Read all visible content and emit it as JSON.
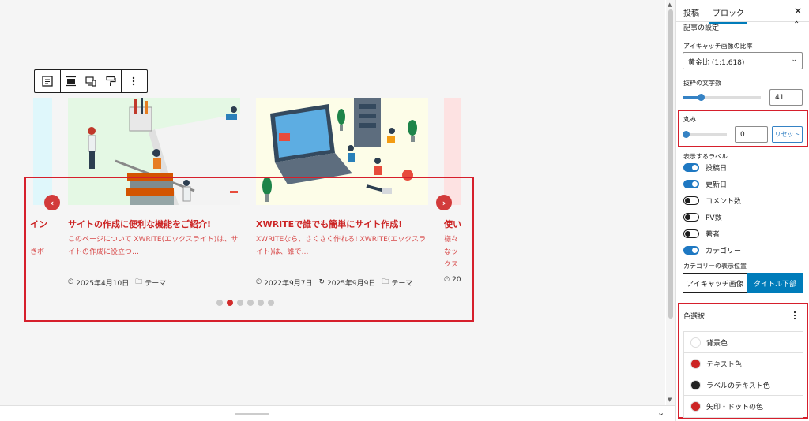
{
  "tabs": {
    "post": "投稿",
    "block": "ブロック"
  },
  "icons": {
    "close": "close-icon",
    "chevron_up": "chevron-up-icon",
    "more": "more-vertical-icon"
  },
  "carousel": {
    "prev_label": "‹",
    "next_label": "›",
    "left_partial": {
      "title": "イン",
      "excerpt": "きボ",
      "meta": "ー"
    },
    "cards": [
      {
        "title": "サイトの作成に便利な機能をご紹介!",
        "excerpt": "このページについて XWRITE(エックスライト)は、サイトの作成に役立つ…",
        "date": "2025年4月10日",
        "category": "テーマ"
      },
      {
        "title": "XWRITEで誰でも簡単にサイト作成!",
        "excerpt": "XWRITEなら、さくさく作れる! XWRITE(エックスライト)は、誰で…",
        "date": "2022年9月7日",
        "updated": "2025年9月9日",
        "category": "テーマ"
      }
    ],
    "right_partial": {
      "title": "使い",
      "excerpt": "様々なックス",
      "meta": "20"
    },
    "dots_total": 6,
    "active_dot": 2
  },
  "sidebar": {
    "section_title": "記事の設定",
    "aspect_label": "アイキャッチ画像の比率",
    "aspect_value": "黄金比 (1:1.618)",
    "excerpt_label": "抜粋の文字数",
    "excerpt_value": "41",
    "radius_label": "丸み",
    "radius_value": "0",
    "reset_label": "リセット",
    "labels_title": "表示するラベル",
    "toggles": [
      {
        "label": "投稿日",
        "on": true
      },
      {
        "label": "更新日",
        "on": true
      },
      {
        "label": "コメント数",
        "on": false
      },
      {
        "label": "PV数",
        "on": false
      },
      {
        "label": "著者",
        "on": false
      },
      {
        "label": "カテゴリー",
        "on": true
      }
    ],
    "cat_pos_label": "カテゴリーの表示位置",
    "cat_pos_options": [
      "アイキャッチ画像",
      "タイトル下部"
    ],
    "color_title": "色選択",
    "colors": [
      {
        "label": "背景色",
        "color": "#ffffff"
      },
      {
        "label": "テキスト色",
        "color": "#cc2424"
      },
      {
        "label": "ラベルのテキスト色",
        "color": "#222222"
      },
      {
        "label": "矢印・ドットの色",
        "color": "#cc2424"
      }
    ]
  },
  "accent": "#007cba",
  "theme_red": "#cc2424"
}
